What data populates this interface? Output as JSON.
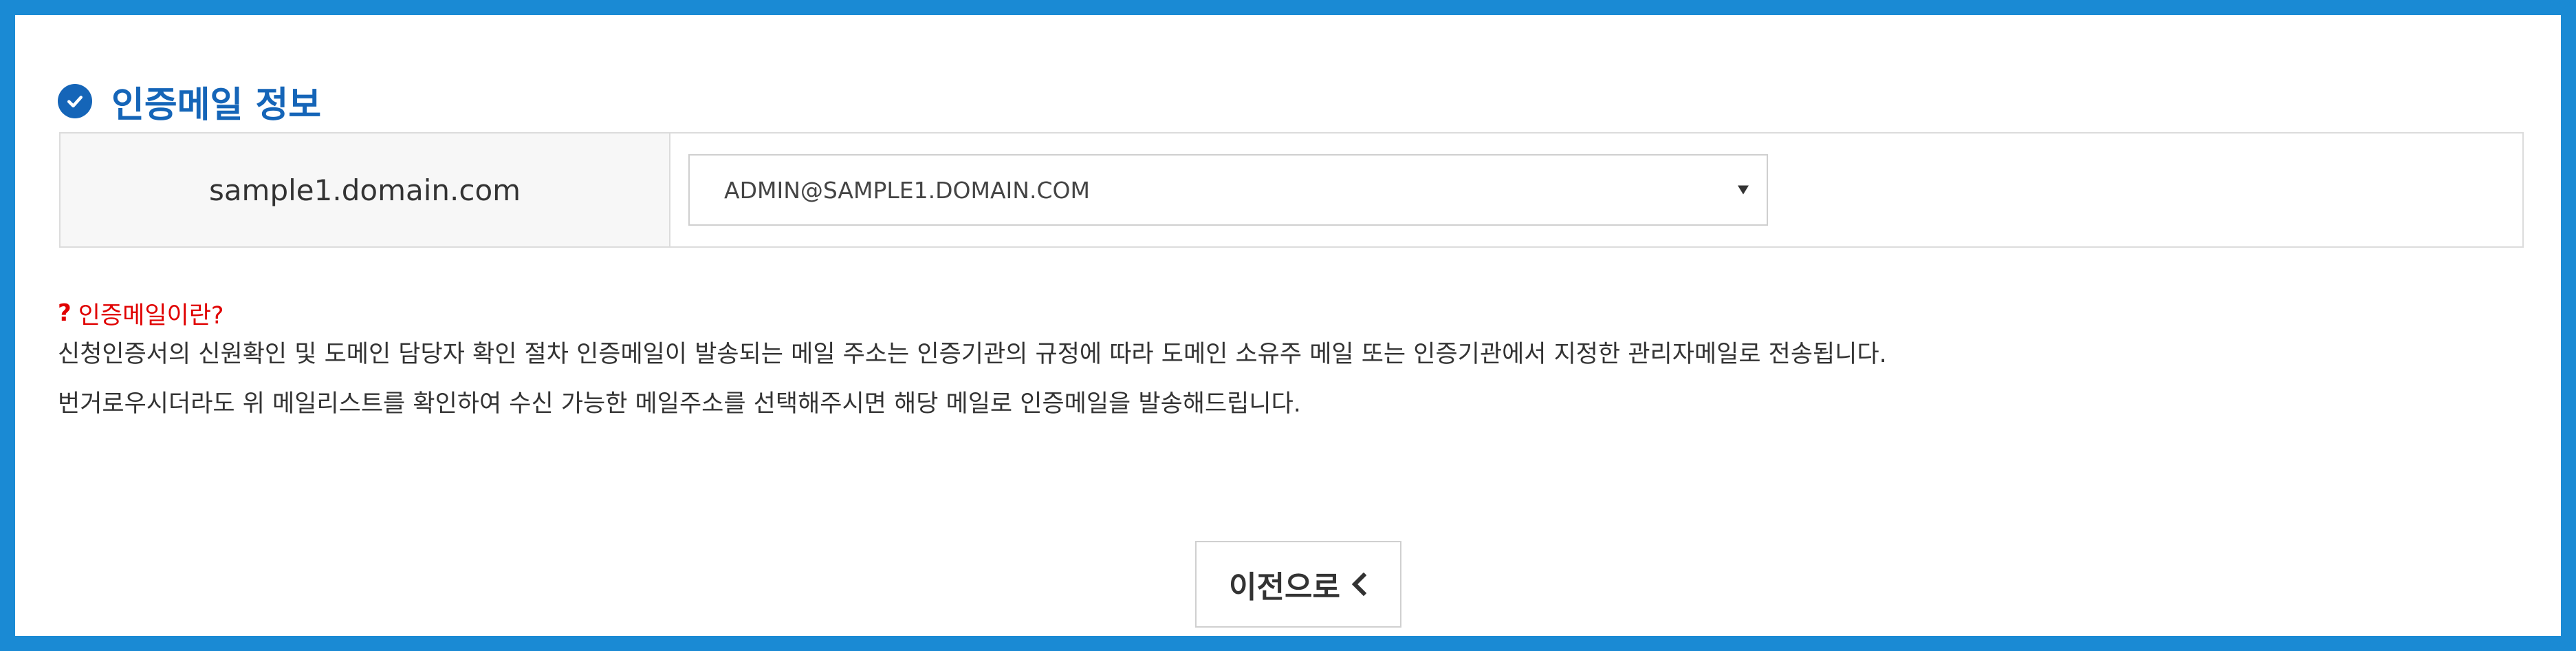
{
  "section": {
    "title": "인증메일 정보",
    "icon": "check-circle-icon",
    "accent_color": "#1565b8"
  },
  "email_table": {
    "domain": "sample1.domain.com",
    "selected_email": "ADMIN@SAMPLE1.DOMAIN.COM"
  },
  "help": {
    "icon": "?",
    "heading": "인증메일이란?",
    "heading_color": "#e00000",
    "lines": [
      "신청인증서의 신원확인 및 도메인 담당자 확인 절차 인증메일이 발송되는 메일 주소는 인증기관의 규정에 따라 도메인 소유주 메일 또는 인증기관에서 지정한 관리자메일로 전송됩니다.",
      "번거로우시더라도 위 메일리스트를 확인하여 수신 가능한 메일주소를 선택해주시면 해당 메일로 인증메일을 발송해드립니다."
    ]
  },
  "buttons": {
    "prev_label": "이전으로",
    "prev_icon": "chevron-left-icon"
  },
  "colors": {
    "frame_border": "#1a8ad4",
    "table_border": "#dcdcdc",
    "domain_cell_bg": "#f7f7f7"
  }
}
